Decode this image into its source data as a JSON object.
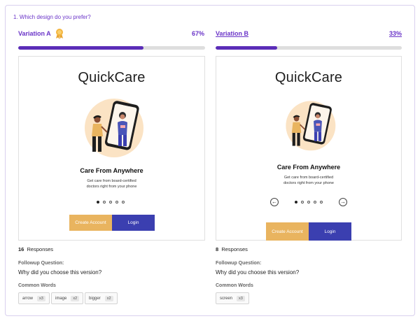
{
  "question": "1.  Which design do you prefer?",
  "variations": [
    {
      "title": "Variation A",
      "percent_label": "67%",
      "percent": 67,
      "winner": true,
      "brand": "QuickCare",
      "headline": "Care From Anywhere",
      "sub_line1": "Get care from board-certified",
      "sub_line2": "doctors right from your phone",
      "create_label": "Create Account",
      "login_label": "Login",
      "responses_count": "16",
      "responses_label": "Responses",
      "followup_label": "Followup Question:",
      "followup_text": "Why did you choose this version?",
      "words_label": "Common Words",
      "words": [
        {
          "word": "arrow",
          "count": "x3"
        },
        {
          "word": "image",
          "count": "x2"
        },
        {
          "word": "bigger",
          "count": "x2"
        }
      ]
    },
    {
      "title": "Variation B",
      "percent_label": "33%",
      "percent": 33,
      "winner": false,
      "brand": "QuickCare",
      "headline": "Care From Anywhere",
      "sub_line1": "Get care from board-certified",
      "sub_line2": "doctors right from your phone",
      "create_label": "Create Account",
      "login_label": "Login",
      "responses_count": "8",
      "responses_label": "Responses",
      "followup_label": "Followup Question:",
      "followup_text": "Why did you choose this version?",
      "words_label": "Common Words",
      "words": [
        {
          "word": "screen",
          "count": "x3"
        }
      ]
    }
  ],
  "colors": {
    "accent": "#6a34c8",
    "bar_fill": "#5b2db8",
    "create_button": "#e9b45f",
    "login_button": "#3b3fb0",
    "illustration_circle": "#fbe3c4"
  },
  "icons": {
    "winner": "award-ribbon-icon",
    "prev": "arrow-left-icon",
    "next": "arrow-right-icon"
  }
}
